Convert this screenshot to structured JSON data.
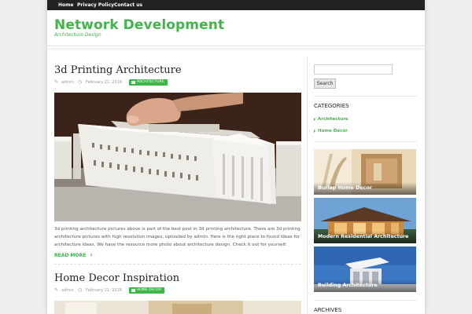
{
  "nav": {
    "items": [
      {
        "label": "Home"
      },
      {
        "label": "Privacy Policy"
      },
      {
        "label": "Contact us"
      }
    ]
  },
  "site": {
    "title": "Network Development",
    "tagline": "Architecture Design"
  },
  "posts": [
    {
      "title": "3d Printing Architecture",
      "author": "admin",
      "date": "February 21, 2016",
      "category": "ARCHITECTURE",
      "excerpt": "3d printing architecture pictures above is part of the best post in 3d printing architecture. There are 3d printing architecture pictures with high resolution images, uploaded by admin. Here is the right place to found ideas for architecture ideas. We have the resource more photo about architecture design. Check it out for yourself.",
      "read_more": "READ MORE"
    },
    {
      "title": "Home Decor Inspiration",
      "author": "admin",
      "date": "February 21, 2016",
      "category": "HOME DECOR"
    }
  ],
  "sidebar": {
    "search": {
      "value": "",
      "button_label": "Search"
    },
    "categories_title": "CATEGORIES",
    "categories": [
      {
        "label": "Architecture"
      },
      {
        "label": "Home Decor"
      }
    ],
    "featured": [
      {
        "label": "Burlap Home Decor"
      },
      {
        "label": "Modern Residential Architecture"
      },
      {
        "label": "Building Architecture"
      }
    ],
    "archives_title": "ARCHIVES"
  },
  "colors": {
    "accent": "#3fb54a",
    "topbar": "#222222",
    "page_background": "#efefef"
  },
  "icons": {
    "author": "user-icon",
    "date": "clock-icon",
    "category": "folder-icon",
    "read_more": "chevron-right-icon"
  }
}
